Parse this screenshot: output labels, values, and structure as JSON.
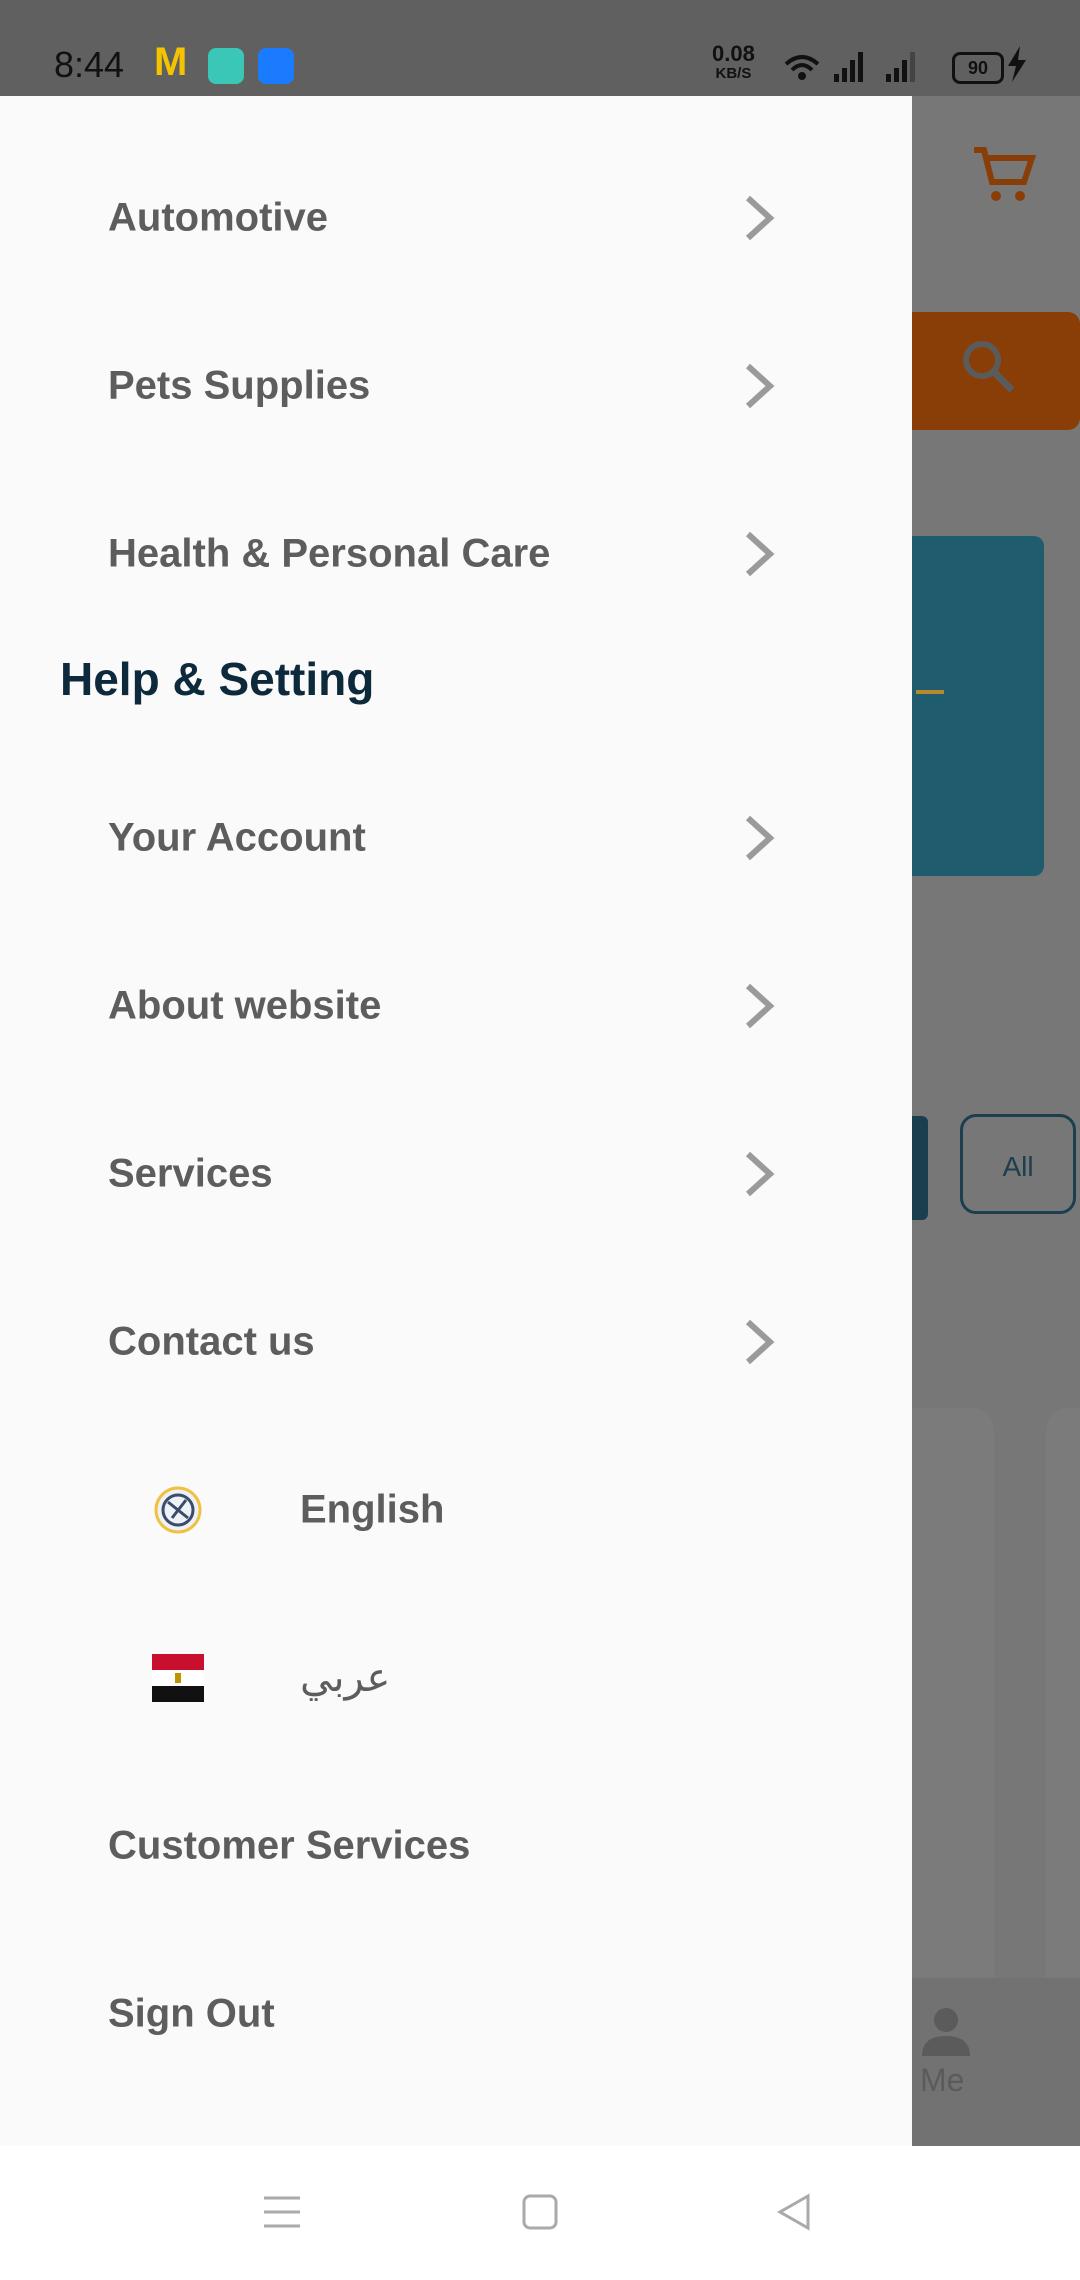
{
  "status_bar": {
    "time": "8:44",
    "net_speed": "0.08",
    "net_unit": "KB/S",
    "battery": "90",
    "m_glyph": "M"
  },
  "background_app": {
    "filter_all": "All",
    "nav_me": "Me",
    "accent_color": "#8a3e07"
  },
  "drawer": {
    "category_items": [
      {
        "label": "Automotive"
      },
      {
        "label": "Pets Supplies"
      },
      {
        "label": "Health & Personal Care"
      }
    ],
    "help_section_title": "Help & Setting",
    "help_items": [
      {
        "label": "Your Account"
      },
      {
        "label": "About website"
      },
      {
        "label": "Services"
      },
      {
        "label": "Contact us"
      }
    ],
    "languages": [
      {
        "label": "English",
        "icon": "globe-icon"
      },
      {
        "label": "عربي",
        "icon": "egypt-flag-icon"
      }
    ],
    "customer_services": "Customer Services",
    "sign_out": "Sign Out"
  },
  "system_nav": {
    "icons": [
      "menu-icon",
      "home-icon",
      "back-icon"
    ]
  }
}
